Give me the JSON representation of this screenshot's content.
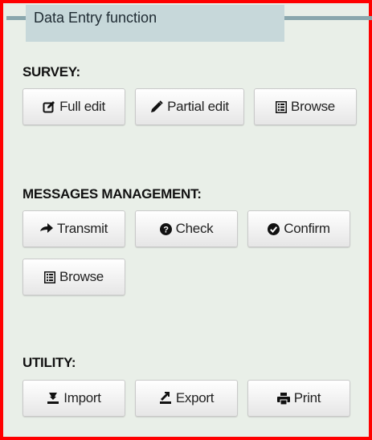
{
  "panel": {
    "title": "Data Entry function"
  },
  "survey": {
    "label": "SURVEY:",
    "buttons": {
      "full_edit": "Full edit",
      "partial_edit": "Partial edit",
      "browse": "Browse"
    }
  },
  "messages": {
    "label": "MESSAGES MANAGEMENT:",
    "buttons": {
      "transmit": "Transmit",
      "check": "Check",
      "confirm": "Confirm",
      "browse": "Browse"
    }
  },
  "utility": {
    "label": "UTILITY:",
    "buttons": {
      "import": "Import",
      "export": "Export",
      "print": "Print"
    }
  },
  "icons": {
    "full_edit": "edit-square-icon",
    "partial_edit": "pencil-icon",
    "browse": "list-icon",
    "transmit": "arrow-right-icon",
    "check": "question-circle-icon",
    "confirm": "check-circle-icon",
    "import": "import-icon",
    "export": "export-icon",
    "print": "printer-icon"
  },
  "colors": {
    "frame_border": "#ff0000",
    "panel_background": "#e9efe8",
    "title_tab": "#c7d8da",
    "title_line": "#8aa7ad"
  }
}
